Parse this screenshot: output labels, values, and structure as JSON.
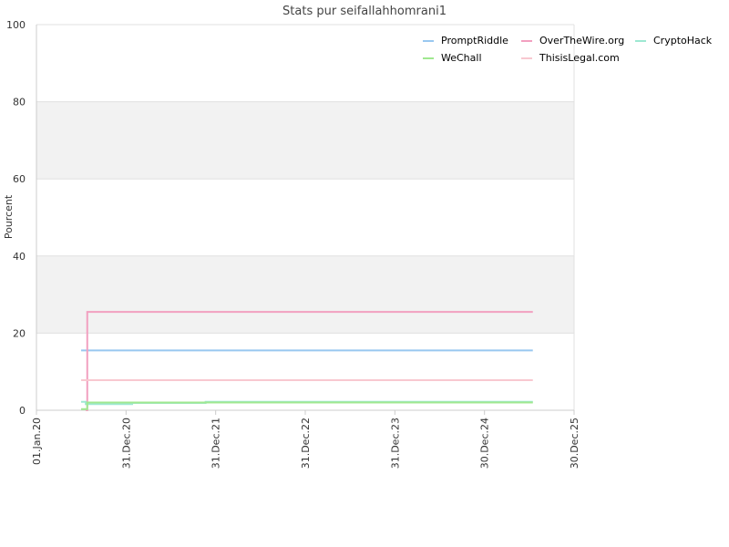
{
  "chart_data": {
    "type": "line",
    "title": "Stats pur seifallahhomrani1",
    "ylabel": "Pourcent",
    "xlabel": "",
    "ylim": [
      0,
      100
    ],
    "yticks": [
      0,
      20,
      40,
      60,
      80,
      100
    ],
    "xlim": [
      "2020-01-01",
      "2025-12-30"
    ],
    "xticks": [
      {
        "date": "2020-01-01",
        "label": "01.Jan.20"
      },
      {
        "date": "2020-12-31",
        "label": "31.Dec.20"
      },
      {
        "date": "2021-12-31",
        "label": "31.Dec.21"
      },
      {
        "date": "2022-12-31",
        "label": "31.Dec.22"
      },
      {
        "date": "2023-12-31",
        "label": "31.Dec.23"
      },
      {
        "date": "2024-12-30",
        "label": "30.Dec.24"
      },
      {
        "date": "2025-12-30",
        "label": "30.Dec.25"
      }
    ],
    "grid": "horizontal bands",
    "legend_position": "top-right",
    "series": [
      {
        "name": "PromptRiddle",
        "color": "#99c8f0",
        "step": true,
        "points": [
          [
            "2020-07-01",
            15.5
          ],
          [
            "2025-07-15",
            15.5
          ]
        ]
      },
      {
        "name": "OverTheWire.org",
        "color": "#f2a0c0",
        "step": true,
        "points": [
          [
            "2020-07-20",
            0.0
          ],
          [
            "2020-07-26",
            25.5
          ],
          [
            "2025-07-15",
            25.5
          ]
        ]
      },
      {
        "name": "CryptoHack",
        "color": "#9ee8d2",
        "step": true,
        "points": [
          [
            "2020-07-01",
            2.2
          ],
          [
            "2020-07-20",
            1.6
          ],
          [
            "2021-01-20",
            1.6
          ],
          [
            "2021-01-25",
            1.9
          ],
          [
            "2021-11-15",
            1.9
          ],
          [
            "2021-11-20",
            2.2
          ],
          [
            "2025-07-15",
            2.2
          ]
        ]
      },
      {
        "name": "WeChall",
        "color": "#a0e890",
        "step": true,
        "points": [
          [
            "2020-07-01",
            0.3
          ],
          [
            "2020-07-20",
            0.3
          ],
          [
            "2020-07-26",
            2.0
          ],
          [
            "2025-07-15",
            2.0
          ]
        ]
      },
      {
        "name": "ThisisLegal.com",
        "color": "#f8c8d0",
        "step": true,
        "points": [
          [
            "2020-07-01",
            7.8
          ],
          [
            "2025-07-15",
            7.8
          ]
        ]
      }
    ],
    "legend_order": [
      "PromptRiddle",
      "OverTheWire.org",
      "CryptoHack",
      "WeChall",
      "ThisisLegal.com"
    ]
  }
}
